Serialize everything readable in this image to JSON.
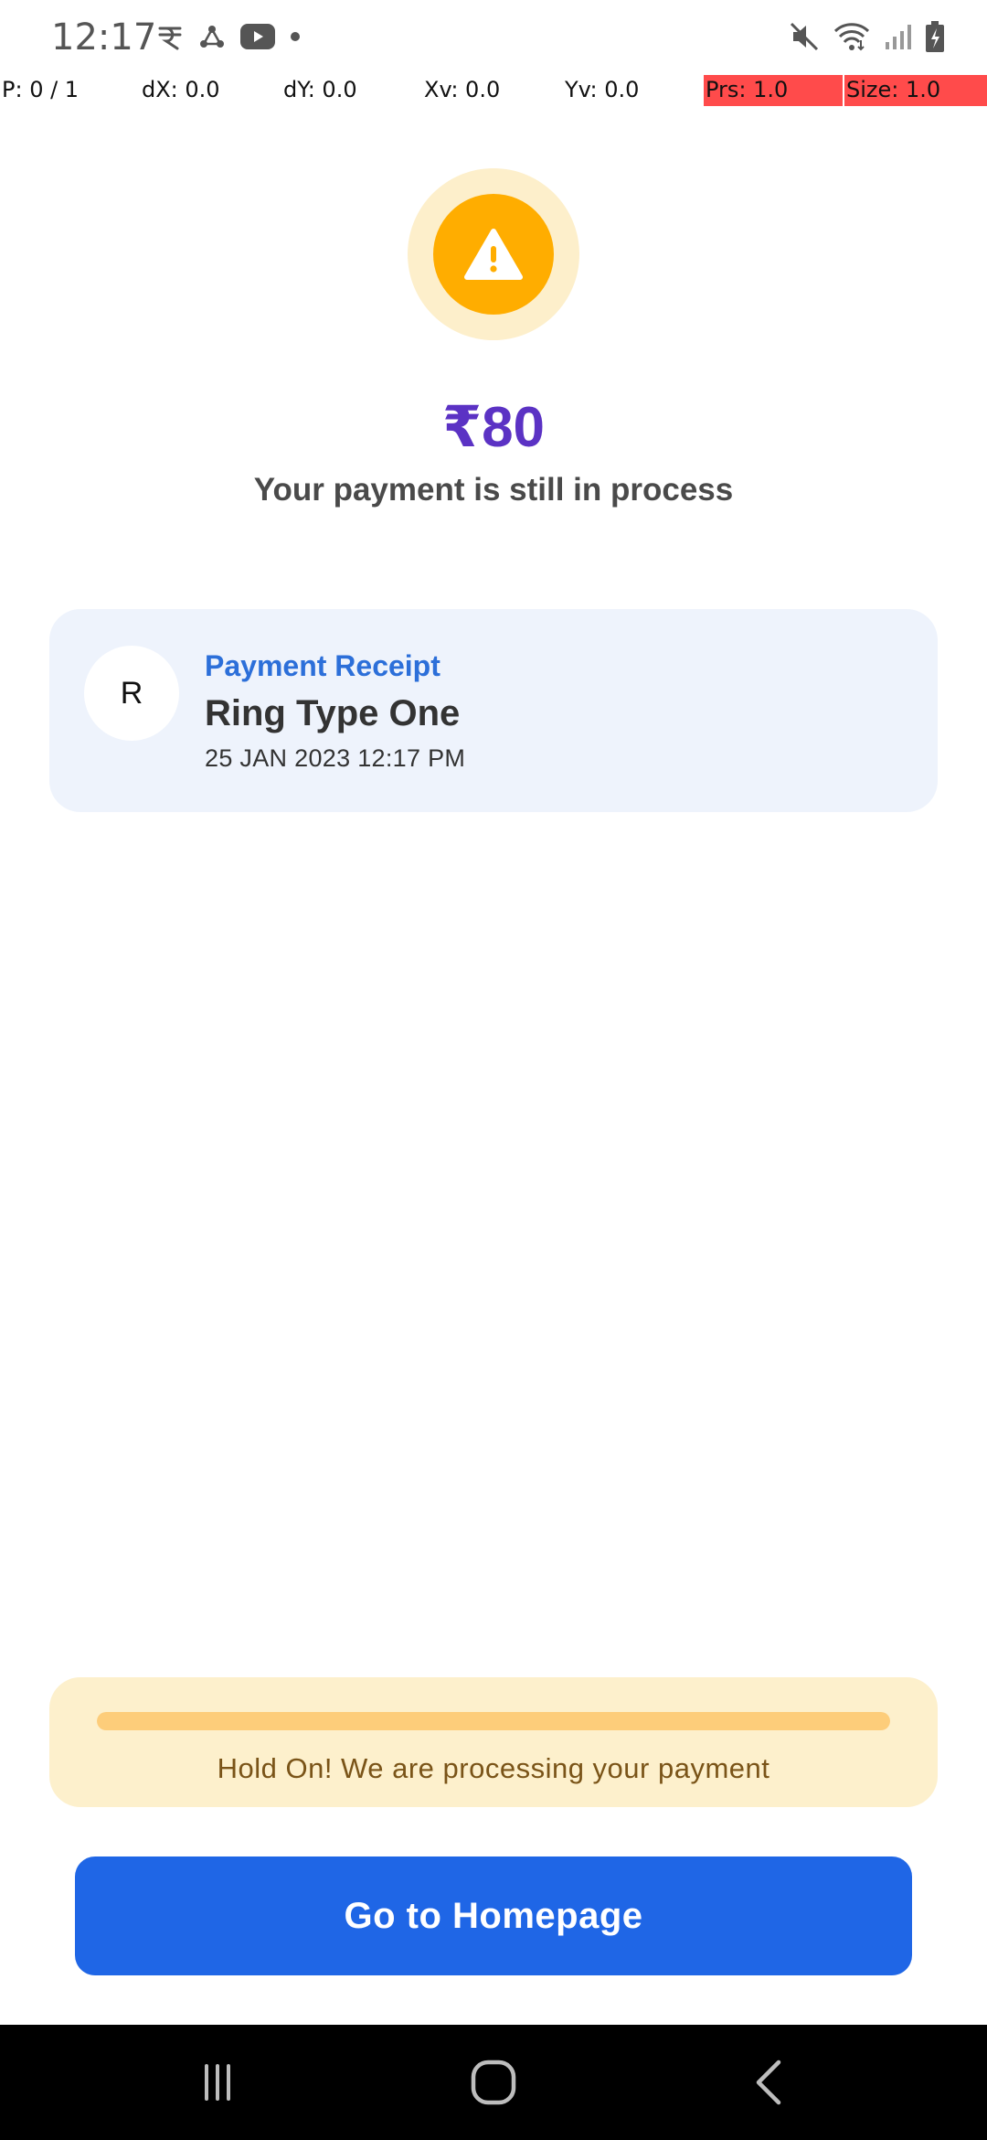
{
  "status_bar": {
    "time": "12:17",
    "left_icons": [
      "rupee-app-icon",
      "share-node-icon",
      "youtube-icon",
      "dot-icon"
    ],
    "right_icons": [
      "mute-icon",
      "wifi-icon",
      "signal-icon",
      "battery-charging-icon"
    ]
  },
  "pointer_bar": {
    "p": "P: 0 / 1",
    "dx": "dX: 0.0",
    "dy": "dY: 0.0",
    "xv": "Xv: 0.0",
    "yv": "Yv: 0.0",
    "prs": "Prs: 1.0",
    "size": "Size: 1.0"
  },
  "payment": {
    "icon": "warning-icon",
    "amount": "₹80",
    "status_message": "Your payment is still in process"
  },
  "receipt": {
    "avatar_letter": "R",
    "label": "Payment Receipt",
    "name": "Ring Type One",
    "date": "25 JAN 2023 12:17 PM"
  },
  "processing": {
    "progress": 1.0,
    "message": "Hold On! We are processing your payment"
  },
  "actions": {
    "home_button_label": "Go to Homepage"
  },
  "nav_bar": {
    "buttons": [
      "recent-apps-icon",
      "home-icon",
      "back-icon"
    ]
  },
  "colors": {
    "accent_purple": "#5b32c4",
    "primary_blue": "#1f66e6",
    "warning_orange": "#ffad00",
    "receipt_label_blue": "#2c6fd9"
  }
}
